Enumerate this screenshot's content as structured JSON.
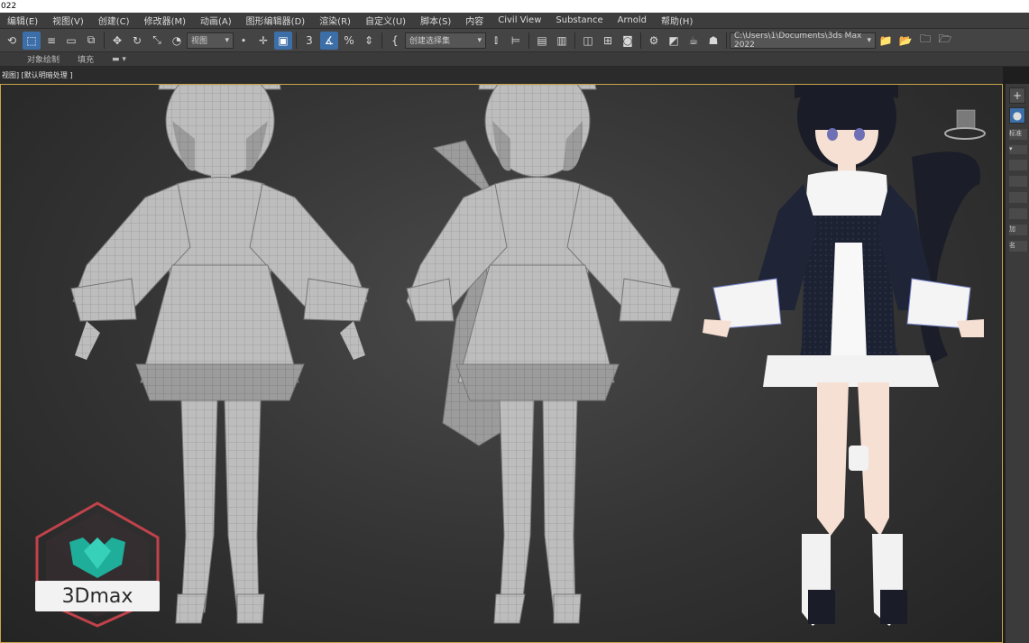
{
  "window": {
    "title_fragment": "022"
  },
  "menu": [
    "编辑(E)",
    "视图(V)",
    "创建(C)",
    "修改器(M)",
    "动画(A)",
    "图形编辑器(D)",
    "渲染(R)",
    "自定义(U)",
    "脚本(S)",
    "内容",
    "Civil View",
    "Substance",
    "Arnold",
    "帮助(H)"
  ],
  "toolbar": {
    "view_dropdown": "视图",
    "selection_set_dropdown": "创建选择集",
    "path": "C:\\Users\\1\\Documents\\3ds Max 2022",
    "angle_snap_label": "3",
    "percent_snap_label": "%"
  },
  "subbar": {
    "left_label": "对象绘制",
    "fill_label": "填充"
  },
  "viewport": {
    "label": "视图] [默认明暗处理 ]"
  },
  "right_panel": {
    "label_std": "标准",
    "label_add": "加",
    "label_name": "名"
  },
  "logo": {
    "text": "3Dmax"
  },
  "colors": {
    "accent": "#3c6ea8",
    "viewport_border": "#c9a44a",
    "logo_teal": "#1fae9a",
    "logo_red": "#c0424a"
  }
}
